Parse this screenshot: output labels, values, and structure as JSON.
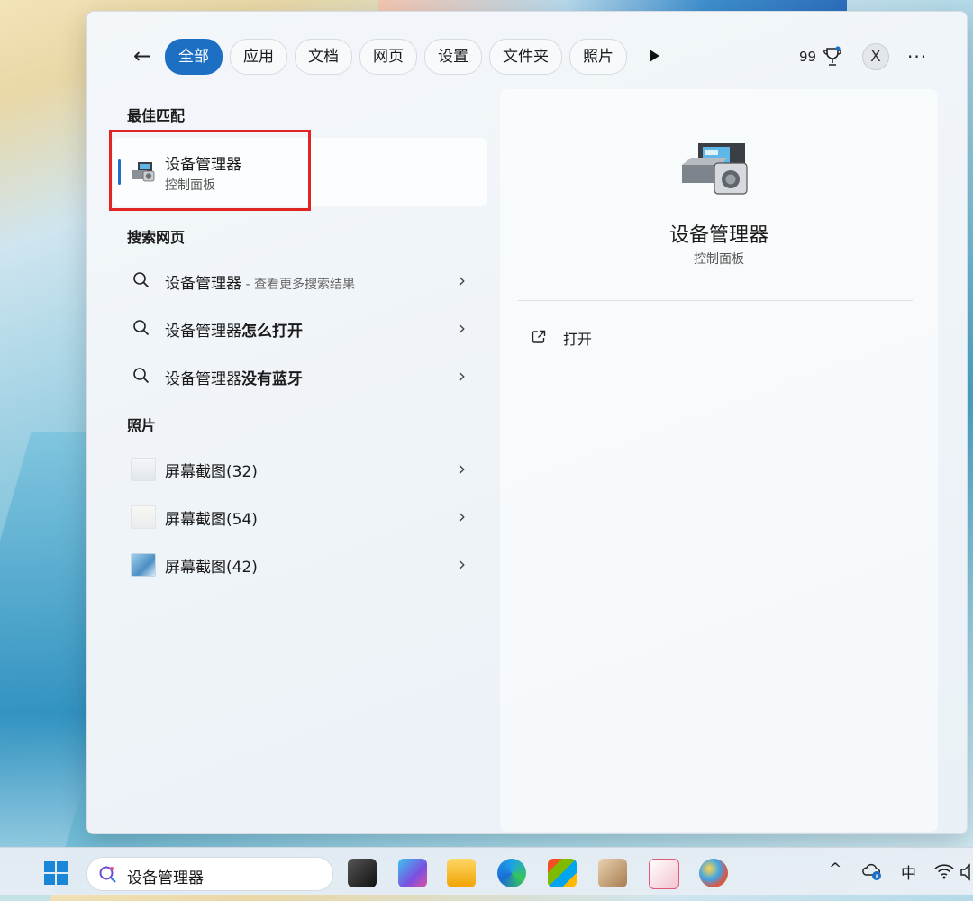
{
  "filters": {
    "tabs": [
      {
        "label": "全部"
      },
      {
        "label": "应用"
      },
      {
        "label": "文档"
      },
      {
        "label": "网页"
      },
      {
        "label": "设置"
      },
      {
        "label": "文件夹"
      },
      {
        "label": "照片"
      }
    ],
    "points": "99",
    "avatar_initial": "X"
  },
  "best_match": {
    "heading": "最佳匹配",
    "title": "设备管理器",
    "subtitle": "控制面板"
  },
  "web": {
    "heading": "搜索网页",
    "items": [
      {
        "query": "设备管理器",
        "suffix": "",
        "hint": " - 查看更多搜索结果"
      },
      {
        "query": "设备管理器",
        "suffix": "怎么打开",
        "hint": ""
      },
      {
        "query": "设备管理器",
        "suffix": "没有蓝牙",
        "hint": ""
      }
    ]
  },
  "photos": {
    "heading": "照片",
    "items": [
      {
        "label": "屏幕截图(32)"
      },
      {
        "label": "屏幕截图(54)"
      },
      {
        "label": "屏幕截图(42)"
      }
    ]
  },
  "preview": {
    "title": "设备管理器",
    "subtitle": "控制面板",
    "open_label": "打开"
  },
  "taskbar": {
    "search_value": "设备管理器",
    "ime_label": "中"
  },
  "colors": {
    "accent": "#1d6fc4",
    "highlight": "#e02424"
  }
}
